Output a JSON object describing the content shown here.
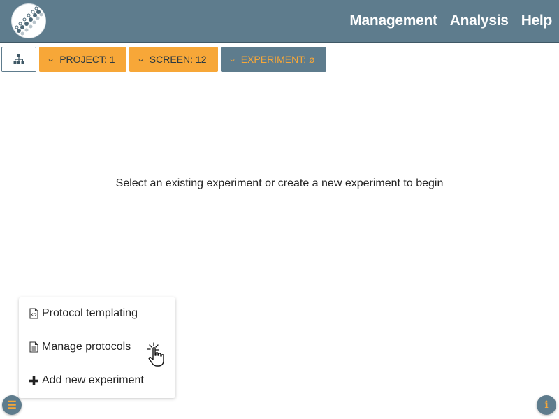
{
  "header": {
    "logo_icon": "dna-helix-logo-icon",
    "nav": [
      {
        "label": "Management"
      },
      {
        "label": "Analysis"
      },
      {
        "label": "Help"
      }
    ]
  },
  "breadcrumbs": {
    "tree_icon": "hierarchy-icon",
    "items": [
      {
        "label": "PROJECT: 1",
        "icon": "chevron-down-icon"
      },
      {
        "label": "SCREEN: 12",
        "icon": "chevron-down-icon"
      },
      {
        "label": "EXPERIMENT: ø",
        "icon": "chevron-down-icon"
      }
    ]
  },
  "main": {
    "message": "Select an existing experiment or create a new experiment to begin"
  },
  "menu": {
    "items": [
      {
        "label": "Protocol templating",
        "icon": "code-file-icon"
      },
      {
        "label": "Manage protocols",
        "icon": "document-icon"
      },
      {
        "label": "Add new experiment",
        "icon": "plus-icon"
      }
    ]
  },
  "fabs": {
    "menu_icon": "hamburger-icon",
    "info_icon": "info-icon"
  },
  "colors": {
    "header_bg": "#5e7c8d",
    "accent_orange": "#f7a738",
    "dark_line": "#3f5866"
  }
}
